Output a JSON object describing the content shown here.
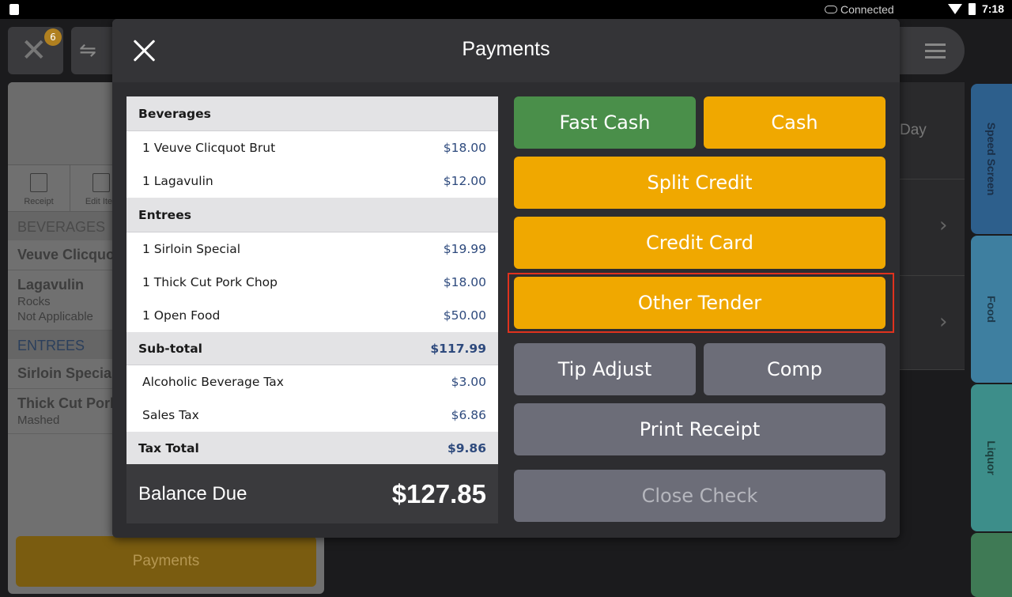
{
  "status_bar": {
    "connection": "Connected",
    "time": "7:18"
  },
  "background": {
    "badge_count": "6",
    "toolbar": {
      "receipt": "Receipt",
      "edit_items": "Edit Iten"
    },
    "sections": [
      {
        "label": "BEVERAGES"
      },
      {
        "label": "ENTREES"
      }
    ],
    "items": [
      {
        "title": "Veuve Clicquo",
        "sub": []
      },
      {
        "title": "Lagavulin",
        "sub": [
          "Rocks",
          "Not Applicable"
        ]
      },
      {
        "title": "Sirloin Special",
        "sub": []
      },
      {
        "title": "Thick Cut Pork",
        "sub": [
          "Mashed"
        ]
      }
    ],
    "payments_label": "Payments",
    "middle_day": "Day",
    "tabs": [
      "Speed Screen",
      "Food",
      "Liquor"
    ]
  },
  "modal": {
    "title": "Payments",
    "check": {
      "rows": [
        {
          "type": "header",
          "name": "Beverages"
        },
        {
          "type": "item",
          "name": "1 Veuve Clicquot Brut",
          "price": "$18.00"
        },
        {
          "type": "item",
          "name": "1 Lagavulin",
          "price": "$12.00"
        },
        {
          "type": "header",
          "name": "Entrees"
        },
        {
          "type": "item",
          "name": "1 Sirloin Special",
          "price": "$19.99"
        },
        {
          "type": "item",
          "name": "1 Thick Cut Pork Chop",
          "price": "$18.00"
        },
        {
          "type": "item",
          "name": "1 Open Food",
          "price": "$50.00"
        },
        {
          "type": "total",
          "name": "Sub-total",
          "price": "$117.99"
        },
        {
          "type": "item",
          "name": "Alcoholic Beverage Tax",
          "price": "$3.00"
        },
        {
          "type": "item",
          "name": "Sales Tax",
          "price": "$6.86"
        },
        {
          "type": "total",
          "name": "Tax Total",
          "price": "$9.86"
        }
      ],
      "balance_label": "Balance Due",
      "balance_amount": "$127.85"
    },
    "buttons": {
      "fast_cash": "Fast Cash",
      "cash": "Cash",
      "split_credit": "Split Credit",
      "credit_card": "Credit Card",
      "other_tender": "Other Tender",
      "tip_adjust": "Tip Adjust",
      "comp": "Comp",
      "print_receipt": "Print Receipt",
      "close_check": "Close Check"
    }
  },
  "colors": {
    "green": "#4a8f4a",
    "orange": "#f0a800",
    "gray": "#6c6d78",
    "highlight": "#e0321e"
  }
}
